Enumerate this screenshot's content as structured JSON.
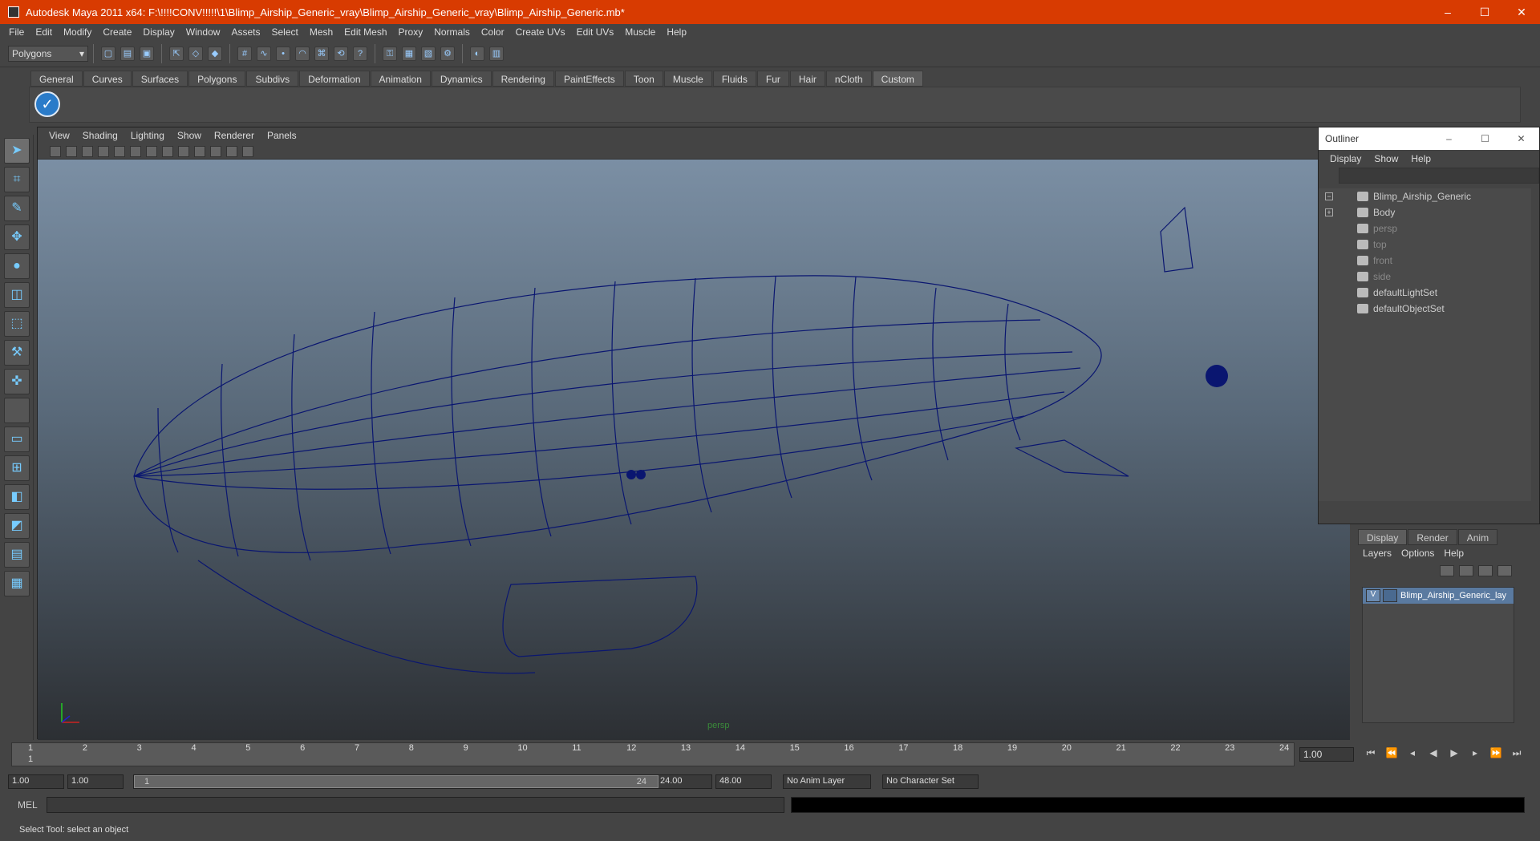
{
  "window": {
    "title": "Autodesk Maya 2011 x64: F:\\!!!!CONV!!!!!\\1\\Blimp_Airship_Generic_vray\\Blimp_Airship_Generic_vray\\Blimp_Airship_Generic.mb*",
    "controls": [
      "–",
      "☐",
      "✕"
    ]
  },
  "menubar": [
    "File",
    "Edit",
    "Modify",
    "Create",
    "Display",
    "Window",
    "Assets",
    "Select",
    "Mesh",
    "Edit Mesh",
    "Proxy",
    "Normals",
    "Color",
    "Create UVs",
    "Edit UVs",
    "Muscle",
    "Help"
  ],
  "toolbar": {
    "mode": "Polygons"
  },
  "shelf": {
    "tabs": [
      "General",
      "Curves",
      "Surfaces",
      "Polygons",
      "Subdivs",
      "Deformation",
      "Animation",
      "Dynamics",
      "Rendering",
      "PaintEffects",
      "Toon",
      "Muscle",
      "Fluids",
      "Fur",
      "Hair",
      "nCloth",
      "Custom"
    ],
    "active_tab": "Custom"
  },
  "viewport": {
    "menu": [
      "View",
      "Shading",
      "Lighting",
      "Show",
      "Renderer",
      "Panels"
    ],
    "camera": "persp"
  },
  "outliner": {
    "title": "Outliner",
    "menu": [
      "Display",
      "Show",
      "Help"
    ],
    "items": [
      {
        "label": "Blimp_Airship_Generic",
        "dim": false
      },
      {
        "label": "Body",
        "dim": false
      },
      {
        "label": "persp",
        "dim": true
      },
      {
        "label": "top",
        "dim": true
      },
      {
        "label": "front",
        "dim": true
      },
      {
        "label": "side",
        "dim": true
      },
      {
        "label": "defaultLightSet",
        "dim": false
      },
      {
        "label": "defaultObjectSet",
        "dim": false
      }
    ]
  },
  "layers": {
    "tabs": [
      "Display",
      "Render",
      "Anim"
    ],
    "active_tab": "Display",
    "menu": [
      "Layers",
      "Options",
      "Help"
    ],
    "rows": [
      {
        "visible": "V",
        "name": "Blimp_Airship_Generic_lay"
      }
    ]
  },
  "timeline": {
    "ticks": [
      "1",
      "2",
      "3",
      "4",
      "5",
      "6",
      "7",
      "8",
      "9",
      "10",
      "11",
      "12",
      "13",
      "14",
      "15",
      "16",
      "17",
      "18",
      "19",
      "20",
      "21",
      "22",
      "23",
      "24"
    ],
    "current_frame_marker": "1",
    "current_frame": "1.00"
  },
  "range": {
    "start": "1.00",
    "start2": "1.00",
    "slider_start": "1",
    "slider_end": "24",
    "end": "24.00",
    "end2": "48.00",
    "anim_layer": "No Anim Layer",
    "char_set": "No Character Set"
  },
  "mel": {
    "label": "MEL"
  },
  "help_line": "Select Tool: select an object"
}
